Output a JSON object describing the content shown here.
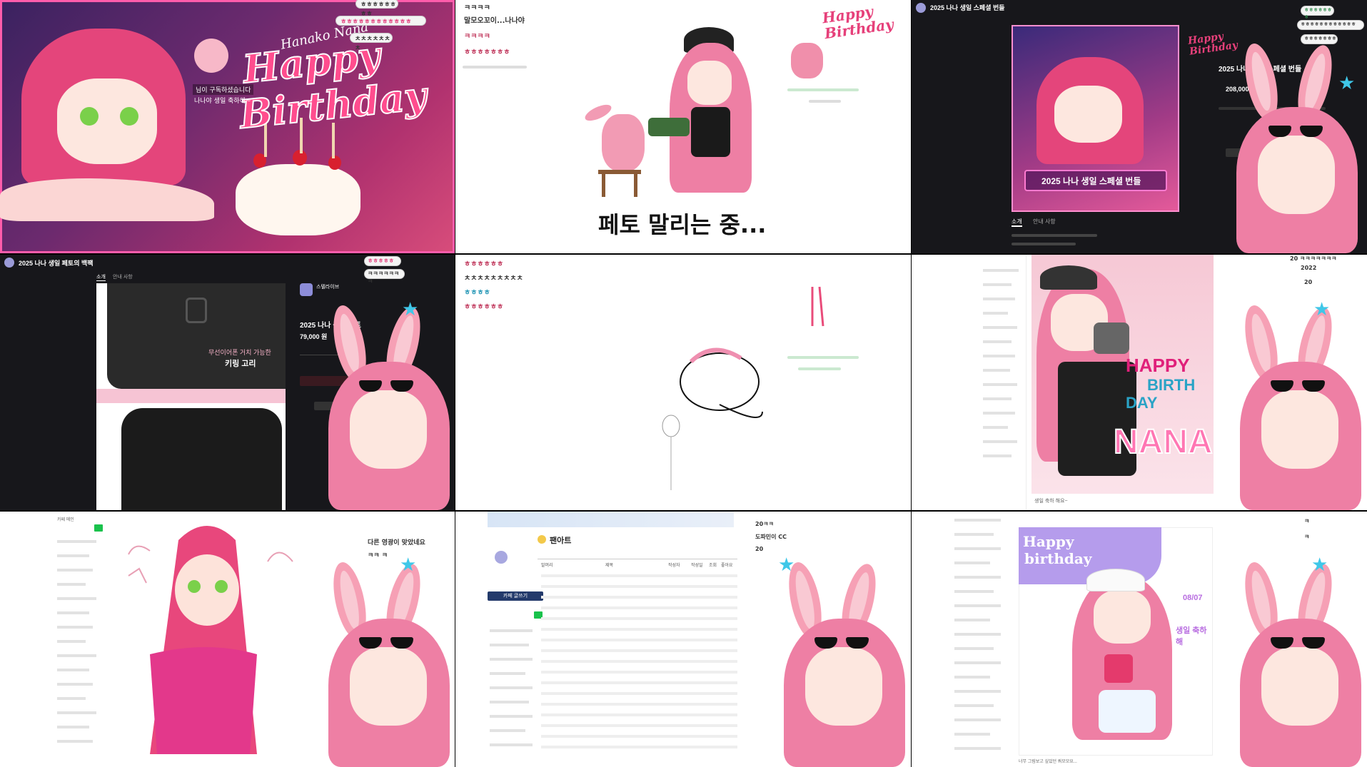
{
  "tile1": {
    "chat_top": "ㅎㅎㅎㅎㅎㅎㅎㅎ",
    "chat_lines": [
      "ㅎㅎㅎㅎㅎㅎㅎㅎㅎㅎㅎㅎ",
      "ㅊㅊㅊㅊㅊㅊㅊ"
    ],
    "signature": "Hanako Nana",
    "headline_1": "Happy",
    "headline_2": "Birthday",
    "donation_text": "님이 구독하셨습니다",
    "donation_sub": "나나야 생일 축하해~"
  },
  "tile2": {
    "chat_lines": [
      "ㅋㅋㅋㅋ",
      "말모오꼬이...나나야",
      "ㅋㅋㅋㅋ",
      "ㅎㅎㅎㅎㅎㅎㅎ"
    ],
    "caption": "페토 말리는 중...",
    "headline": "Happy Birthday"
  },
  "tile3": {
    "page_title": "2025 나나 생일 스페셜 번들",
    "banner_text": "2025 나나 생일 스페셜 번들",
    "product_title": "2025 나나 생일 스페셜 번들",
    "price": "208,000 원",
    "tabs": [
      "소개",
      "안내 사항"
    ],
    "chat_lines": [
      "ㅎㅎㅎㅎㅎㅎㅎ",
      "ㅎㅎㅎㅎㅎㅎㅎㅎㅎㅎㅎㅎ",
      "ㅎㅎㅎㅎㅎㅎㅎ"
    ],
    "headline": "Happy Birthday"
  },
  "tile4": {
    "page_title": "2025 나나 생일 페토의 백팩",
    "tabs": [
      "소개",
      "안내 사항"
    ],
    "shop_name": "스텔라이브",
    "product_title": "2025 나나 생일 페토",
    "price": "79,000 원",
    "feature_label_1": "무선이어폰 거치 가능한",
    "feature_label_2": "키링 고리",
    "chat_lines": [
      "ㅎㅎㅎㅎㅎ",
      "ㅋㅋㅋㅋㅋㅋㅋ"
    ]
  },
  "tile5": {
    "chat_lines": [
      "ㅎㅎㅎㅎㅎㅎ",
      "ㅊㅊㅊㅊㅊㅊㅊㅊㅊ",
      "ㅎㅎㅎㅎ",
      "ㅎㅎㅎㅎㅎㅎ"
    ]
  },
  "tile6": {
    "art_text_1": "HAPPY",
    "art_text_2": "BIRTH",
    "art_text_3": "DAY",
    "art_text_4": "NANA",
    "chat_lines": [
      "20 ㅋㅋㅋㅋㅋㅋㅋ",
      "2022",
      "20"
    ],
    "caption": "생일 축하 해요~"
  },
  "tile7": {
    "chat_lines": [
      "다른 영광이 맞았네요",
      "ㅋㅋ ㅋ"
    ],
    "sidebar_title": "카페 메인"
  },
  "tile8": {
    "board_title": "팬아트",
    "cafe_button": "카페 글쓰기",
    "chat_lines": [
      "20ㅋㅋ",
      "도파민이 CC",
      "20"
    ],
    "columns": [
      "말머리",
      "제목",
      "작성자",
      "작성일",
      "조회",
      "좋아요"
    ]
  },
  "tile9": {
    "art_text_1": "Happy",
    "art_text_2": "birthday",
    "date_text": "08/07",
    "message": "생일 축하해",
    "caption": "너무 그림보고 싶었던 쿼모모요...",
    "chat_lines": [
      "ㅋ",
      "ㅋ"
    ]
  },
  "colors": {
    "pink": "#ee5a8c",
    "hot_pink": "#e62c78",
    "dark_bg": "#17171b",
    "bunny_ear": "#f6a0b5",
    "cyan_star": "#3fc7e8",
    "green_btn": "#19c24c",
    "navy_btn": "#233a6b"
  }
}
